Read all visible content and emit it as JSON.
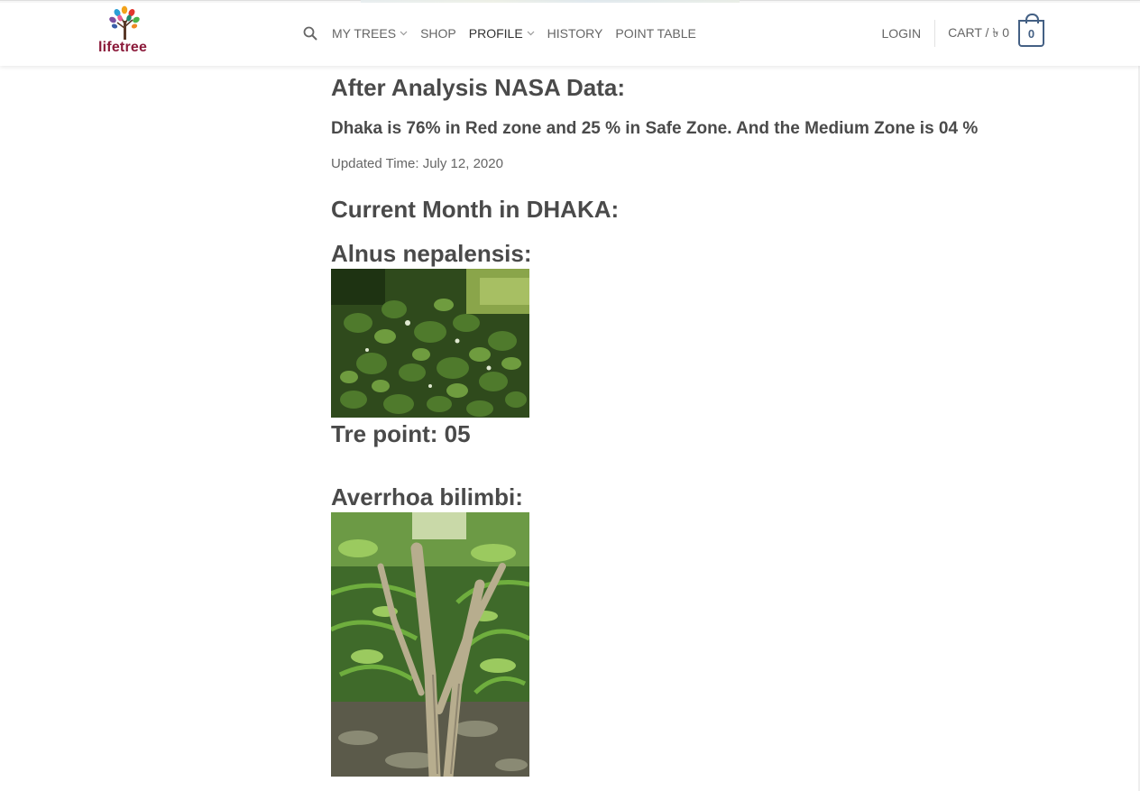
{
  "brand": {
    "name": "lifetree"
  },
  "nav": {
    "search_icon": "search-icon",
    "items": [
      {
        "label": "MY TREES",
        "has_dropdown": true
      },
      {
        "label": "SHOP",
        "has_dropdown": false
      },
      {
        "label": "PROFILE",
        "has_dropdown": true
      },
      {
        "label": "HISTORY",
        "has_dropdown": false
      },
      {
        "label": "POINT TABLE",
        "has_dropdown": false
      }
    ],
    "login": "LOGIN",
    "cart_label": "CART / ৳ 0",
    "cart_count": "0"
  },
  "content": {
    "analysis_heading": "After Analysis NASA Data:",
    "zone_summary": "Dhaka is 76% in Red zone and 25 % in Safe Zone. And the Medium Zone is 04 %",
    "updated": "Updated Time: July 12, 2020",
    "current_heading": "Current Month in DHAKA:",
    "trees": [
      {
        "name": "Alnus nepalensis:",
        "points": "Tre point: 05"
      },
      {
        "name": "Averrhoa bilimbi:"
      }
    ]
  },
  "colors": {
    "brand": "#8b1a3a",
    "accent": "#446084",
    "text": "#4a4a4a"
  }
}
